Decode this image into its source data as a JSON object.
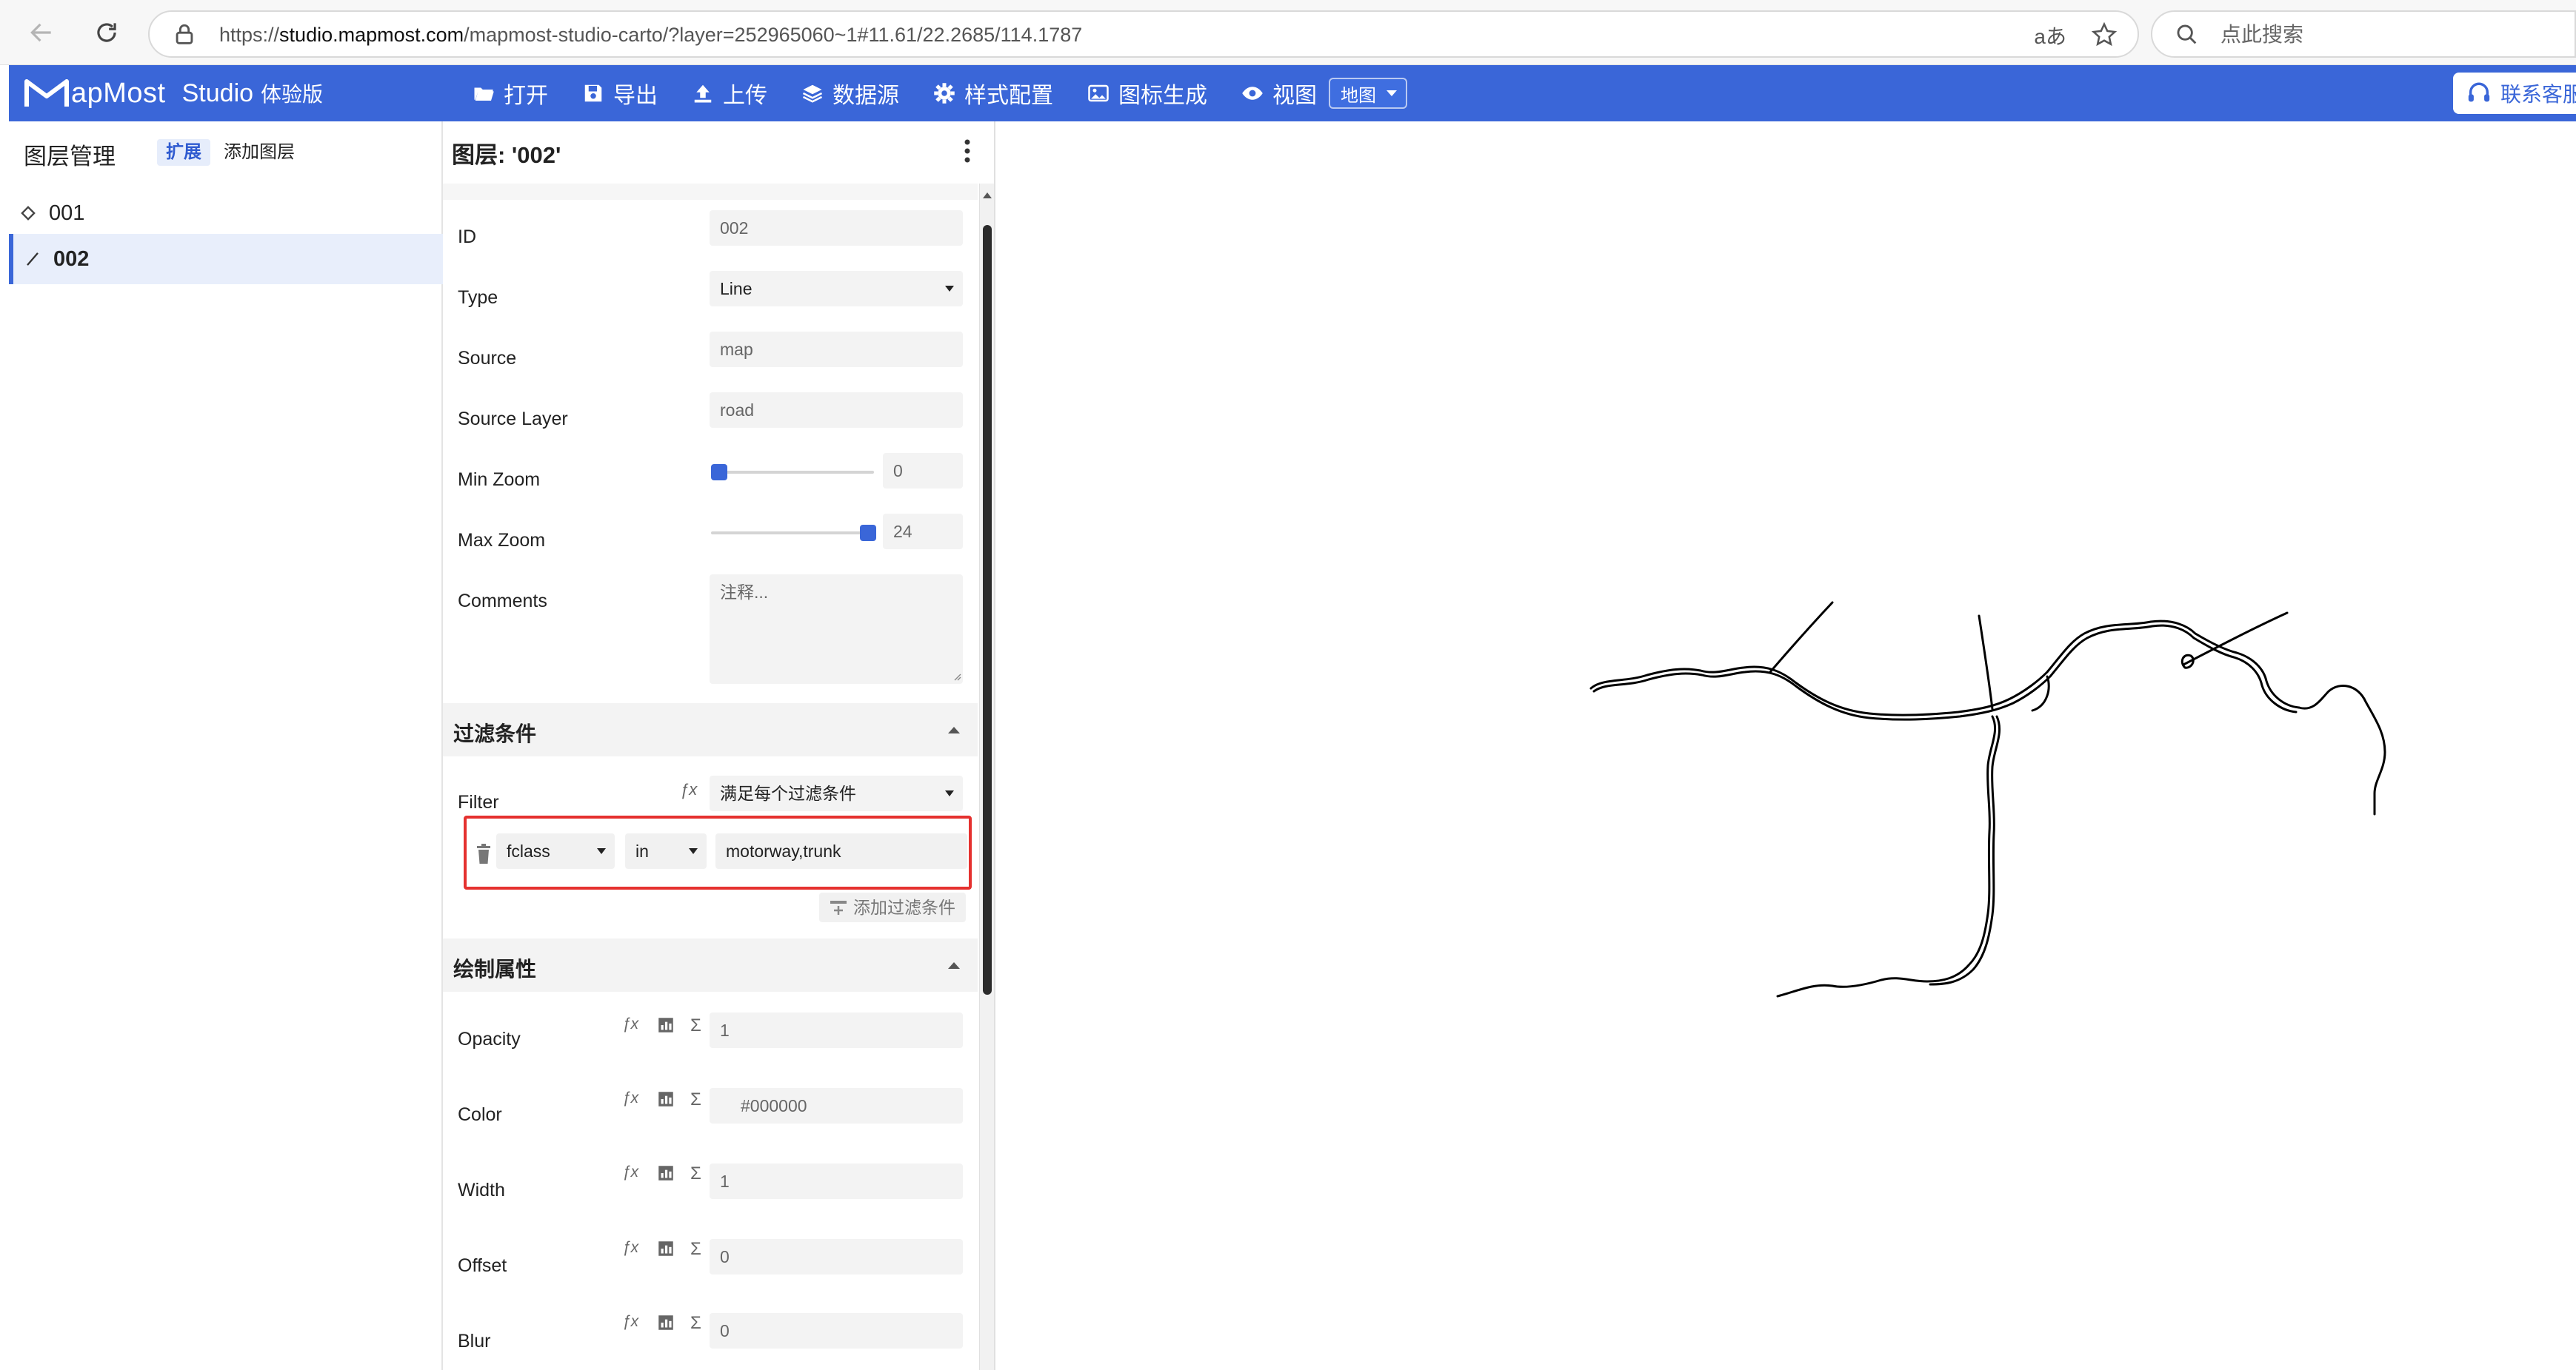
{
  "browser": {
    "url_prefix": "https://",
    "url_host": "studio.mapmost.com",
    "url_path": "/mapmost-studio-carto/?layer=252965060~1#11.61/22.2685/114.1787",
    "translate_glyph": "aあ",
    "search_placeholder": "点此搜索"
  },
  "app": {
    "logo_brand": "apMost",
    "logo_studio": "Studio",
    "logo_edition": "体验版",
    "accent_color": "#3a66d8",
    "menu": [
      {
        "label": "打开",
        "icon": "folder-open-icon"
      },
      {
        "label": "导出",
        "icon": "save-icon"
      },
      {
        "label": "上传",
        "icon": "upload-icon"
      },
      {
        "label": "数据源",
        "icon": "layers-icon"
      },
      {
        "label": "样式配置",
        "icon": "gear-icon"
      },
      {
        "label": "图标生成",
        "icon": "image-icon"
      },
      {
        "label": "视图",
        "icon": "eye-icon"
      }
    ],
    "view_select": "地图",
    "support_label": "联系客服"
  },
  "layers": {
    "title": "图层管理",
    "tab_extend": "扩展",
    "tab_add": "添加图层",
    "items": [
      {
        "name": "001",
        "icon": "diamond-icon",
        "active": false
      },
      {
        "name": "002",
        "icon": "line-icon",
        "active": true
      }
    ]
  },
  "props": {
    "title": "图层: '002'",
    "fields": {
      "id_label": "ID",
      "id_value": "002",
      "type_label": "Type",
      "type_value": "Line",
      "source_label": "Source",
      "source_value": "map",
      "source_layer_label": "Source Layer",
      "source_layer_value": "road",
      "min_zoom_label": "Min Zoom",
      "min_zoom_value": "0",
      "max_zoom_label": "Max Zoom",
      "max_zoom_value": "24",
      "comments_label": "Comments",
      "comments_placeholder": "注释..."
    },
    "filter": {
      "section_title": "过滤条件",
      "filter_label": "Filter",
      "mode_value": "满足每个过滤条件",
      "rule_field": "fclass",
      "rule_op": "in",
      "rule_value": "motorway,trunk",
      "add_label": "添加过滤条件"
    },
    "paint": {
      "section_title": "绘制属性",
      "opacity_label": "Opacity",
      "opacity_value": "1",
      "color_label": "Color",
      "color_value": "#000000",
      "width_label": "Width",
      "width_value": "1",
      "offset_label": "Offset",
      "offset_value": "0",
      "blur_label": "Blur",
      "blur_value": "0"
    },
    "highlight_color": "#e5312f"
  },
  "map": {
    "line_color": "#000000",
    "background": "#ffffff"
  }
}
